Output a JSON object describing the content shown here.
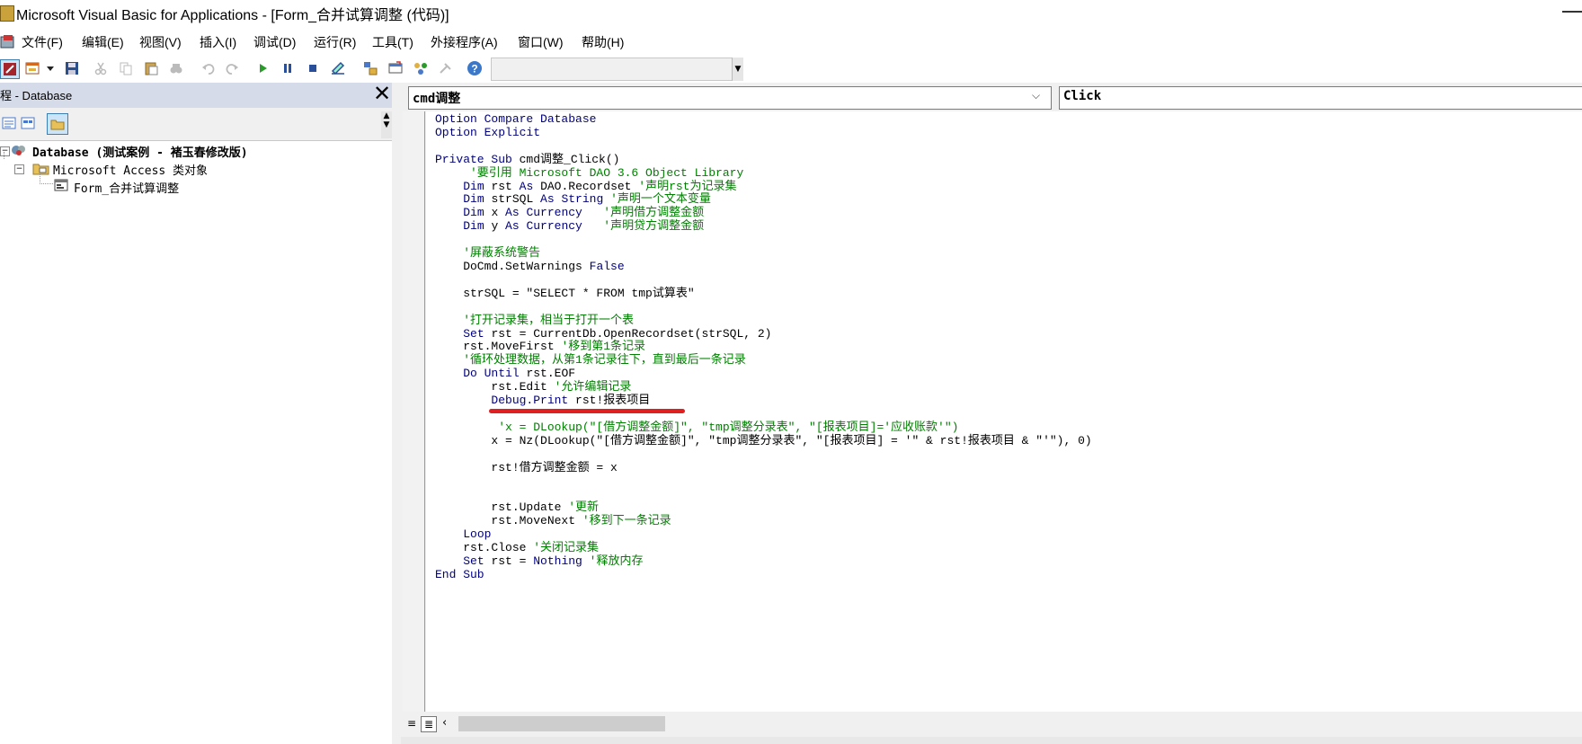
{
  "window": {
    "title": "Microsoft Visual Basic for Applications - [Form_合并试算调整 (代码)]"
  },
  "menu": [
    "文件(F)",
    "编辑(E)",
    "视图(V)",
    "插入(I)",
    "调试(D)",
    "运行(R)",
    "工具(T)",
    "外接程序(A)",
    "窗口(W)",
    "帮助(H)"
  ],
  "toolbar": {
    "icons": [
      "view-access-icon",
      "insert-userform-icon",
      "dropdown-arrow-icon",
      "save-icon",
      "cut-icon",
      "copy-icon",
      "paste-icon",
      "find-icon",
      "undo-icon",
      "redo-icon",
      "run-icon",
      "break-icon",
      "reset-icon",
      "design-mode-icon",
      "project-explorer-icon",
      "properties-window-icon",
      "object-browser-icon",
      "toolbox-icon",
      "help-icon"
    ]
  },
  "project": {
    "title": "程 - Database",
    "close": "✕",
    "tree": {
      "root": "Database (测试案例 - 褚玉春修改版)",
      "folder": "Microsoft Access 类对象",
      "item": "Form_合并试算调整"
    }
  },
  "code": {
    "object": "cmd调整",
    "procedure": "Click",
    "lines": [
      [
        {
          "t": "Option Compare Database",
          "k": 1
        }
      ],
      [
        {
          "t": "Option Explicit",
          "k": 1
        }
      ],
      [
        {
          "t": ""
        }
      ],
      [
        {
          "t": "Private Sub ",
          "k": 1
        },
        {
          "t": "cmd调整_Click()"
        }
      ],
      [
        {
          "t": "     '要引用 Microsoft DAO 3.6 Object Library",
          "c": 1
        }
      ],
      [
        {
          "t": "    "
        },
        {
          "t": "Dim ",
          "k": 1
        },
        {
          "t": "rst "
        },
        {
          "t": "As ",
          "k": 1
        },
        {
          "t": "DAO.Recordset "
        },
        {
          "t": "'声明rst为记录集",
          "c": 1
        }
      ],
      [
        {
          "t": "    "
        },
        {
          "t": "Dim ",
          "k": 1
        },
        {
          "t": "strSQL "
        },
        {
          "t": "As String ",
          "k": 1
        },
        {
          "t": "'声明一个文本变量",
          "c": 1
        }
      ],
      [
        {
          "t": "    "
        },
        {
          "t": "Dim ",
          "k": 1
        },
        {
          "t": "x "
        },
        {
          "t": "As Currency",
          "k": 1
        },
        {
          "t": "   '声明借方调整金额",
          "c": 1
        }
      ],
      [
        {
          "t": "    "
        },
        {
          "t": "Dim ",
          "k": 1
        },
        {
          "t": "y "
        },
        {
          "t": "As Currency",
          "k": 1
        },
        {
          "t": "   '声明贷方调整金额",
          "c": 1
        }
      ],
      [
        {
          "t": ""
        }
      ],
      [
        {
          "t": "    '屏蔽系统警告",
          "c": 1
        }
      ],
      [
        {
          "t": "    DoCmd.SetWarnings "
        },
        {
          "t": "False",
          "k": 1
        }
      ],
      [
        {
          "t": ""
        }
      ],
      [
        {
          "t": "    strSQL = \"SELECT * FROM tmp试算表\""
        }
      ],
      [
        {
          "t": ""
        }
      ],
      [
        {
          "t": "    '打开记录集，相当于打开一个表",
          "c": 1
        }
      ],
      [
        {
          "t": "    "
        },
        {
          "t": "Set ",
          "k": 1
        },
        {
          "t": "rst = CurrentDb.OpenRecordset(strSQL, 2)"
        }
      ],
      [
        {
          "t": "    rst.MoveFirst "
        },
        {
          "t": "'移到第1条记录",
          "c": 1
        }
      ],
      [
        {
          "t": "    '循环处理数据，从第1条记录往下，直到最后一条记录",
          "c": 1
        }
      ],
      [
        {
          "t": "    "
        },
        {
          "t": "Do Until ",
          "k": 1
        },
        {
          "t": "rst.EOF"
        }
      ],
      [
        {
          "t": "        rst.Edit "
        },
        {
          "t": "'允许编辑记录",
          "c": 1
        }
      ],
      [
        {
          "t": "        "
        },
        {
          "t": "Debug.Print ",
          "k": 1
        },
        {
          "t": "rst!报表项目"
        }
      ],
      [
        {
          "t": ""
        }
      ],
      [
        {
          "t": "         'x = DLookup(\"[借方调整金额]\", \"tmp调整分录表\", \"[报表项目]='应收账款'\")",
          "c": 1
        }
      ],
      [
        {
          "t": "        x = Nz(DLookup(\"[借方调整金额]\", \"tmp调整分录表\", \"[报表项目] = '\" & rst!报表项目 & \"'\"), 0)"
        }
      ],
      [
        {
          "t": ""
        }
      ],
      [
        {
          "t": "        rst!借方调整金额 = x"
        }
      ],
      [
        {
          "t": ""
        }
      ],
      [
        {
          "t": ""
        }
      ],
      [
        {
          "t": "        rst.Update "
        },
        {
          "t": "'更新",
          "c": 1
        }
      ],
      [
        {
          "t": "        rst.MoveNext "
        },
        {
          "t": "'移到下一条记录",
          "c": 1
        }
      ],
      [
        {
          "t": "    "
        },
        {
          "t": "Loop",
          "k": 1
        }
      ],
      [
        {
          "t": "    rst.Close "
        },
        {
          "t": "'关闭记录集",
          "c": 1
        }
      ],
      [
        {
          "t": "    "
        },
        {
          "t": "Set ",
          "k": 1
        },
        {
          "t": "rst = "
        },
        {
          "t": "Nothing ",
          "k": 1
        },
        {
          "t": "'释放内存",
          "c": 1
        }
      ],
      [
        {
          "t": "End Sub",
          "k": 1
        }
      ]
    ]
  },
  "colors": {
    "keyword": "#00007f",
    "comment": "#007f00",
    "annotation": "#e02020",
    "pane_header": "#d6dbe9"
  }
}
